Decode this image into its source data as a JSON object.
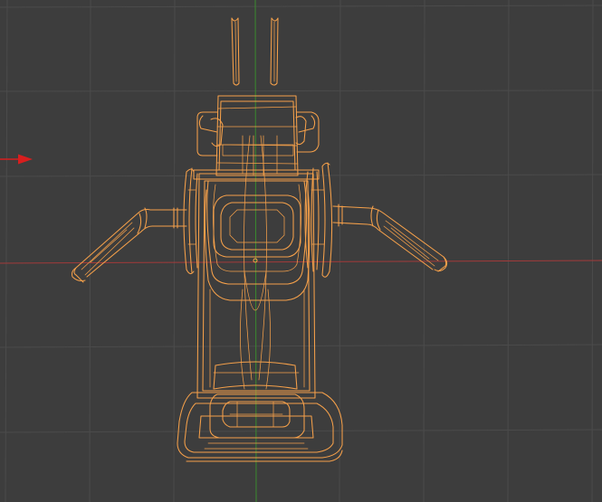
{
  "viewport": {
    "background_color": "#3d3d3d",
    "grid_color": "#4b4b4b",
    "x_axis_color": "#a33a3a",
    "y_axis_color": "#3a8a2e",
    "selection_color": "#f5a04a",
    "arrow_color": "#d81e1e",
    "selected_object": "robot-mesh-wireframe",
    "arrow_icon": "object-origin-arrow-icon"
  }
}
